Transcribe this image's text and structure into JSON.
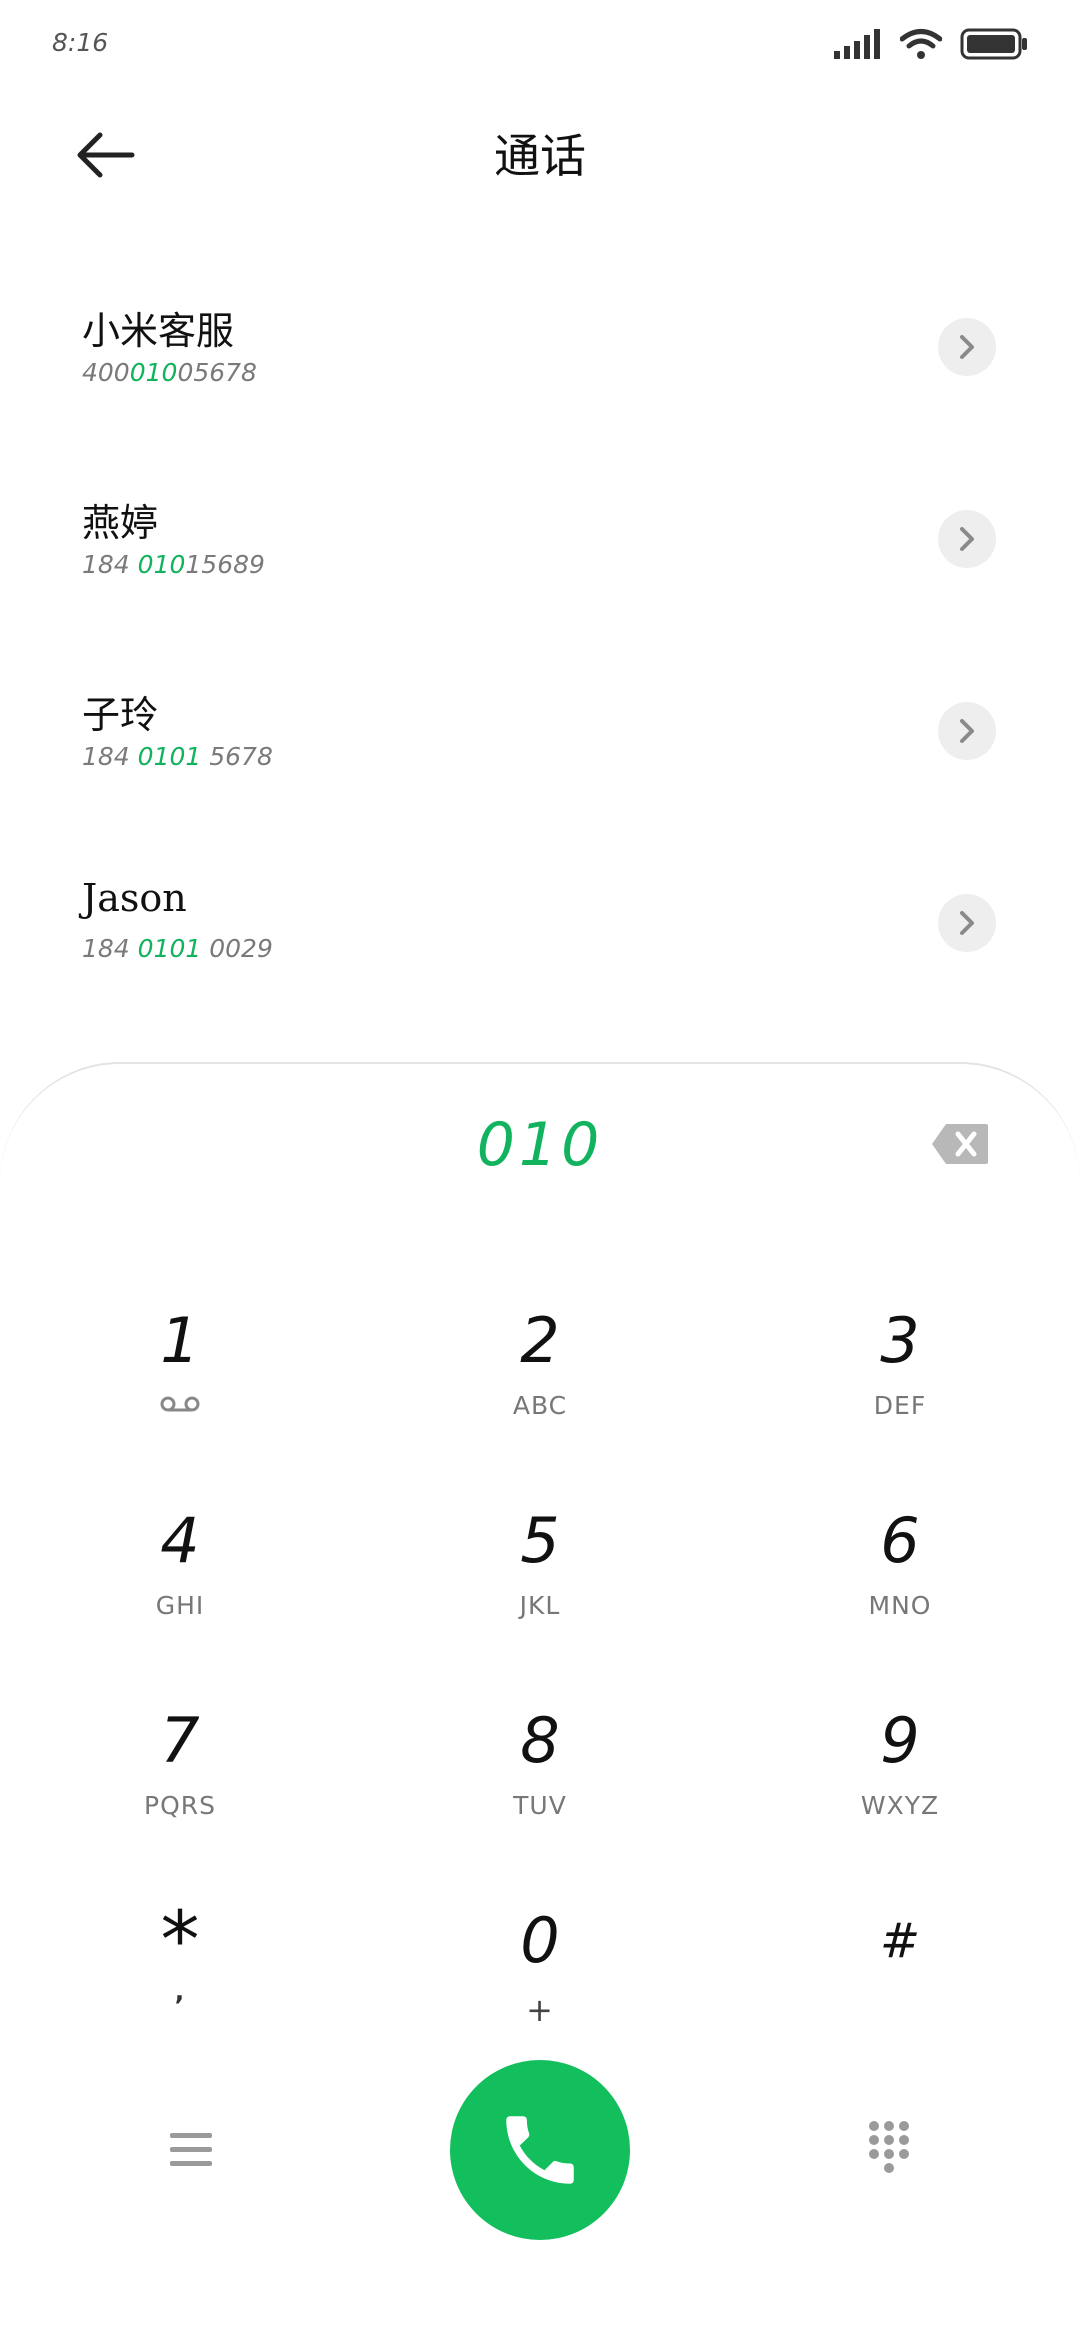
{
  "status_bar": {
    "time": "8:16"
  },
  "header": {
    "title": "通话"
  },
  "contacts": [
    {
      "name": "小米客服",
      "number_pre": "400",
      "number_match": "010",
      "number_post": "05678"
    },
    {
      "name": "燕婷",
      "number_pre": "184 ",
      "number_match": "010",
      "number_post": "15689"
    },
    {
      "name": "子玲",
      "number_pre": "184 ",
      "number_match": "0101",
      "number_post": " 5678"
    },
    {
      "name": "Jason",
      "number_pre": "184 ",
      "number_match": "0101",
      "number_post": " 0029"
    }
  ],
  "dialer": {
    "input_value": "010",
    "keys": [
      {
        "digit": "1",
        "letters": ""
      },
      {
        "digit": "2",
        "letters": "ABC"
      },
      {
        "digit": "3",
        "letters": "DEF"
      },
      {
        "digit": "4",
        "letters": "GHI"
      },
      {
        "digit": "5",
        "letters": "JKL"
      },
      {
        "digit": "6",
        "letters": "MNO"
      },
      {
        "digit": "7",
        "letters": "PQRS"
      },
      {
        "digit": "8",
        "letters": "TUV"
      },
      {
        "digit": "9",
        "letters": "WXYZ"
      },
      {
        "digit": "*",
        "letters": ","
      },
      {
        "digit": "0",
        "letters": "+"
      },
      {
        "digit": "#",
        "letters": ""
      }
    ]
  },
  "colors": {
    "accent": "#12b35e",
    "call_button": "#12bf5c"
  },
  "icons": {
    "back": "arrow-left-icon",
    "delete": "backspace-icon",
    "voicemail": "voicemail-icon",
    "menu": "menu-icon",
    "call": "phone-icon",
    "keypad": "dialpad-icon"
  }
}
